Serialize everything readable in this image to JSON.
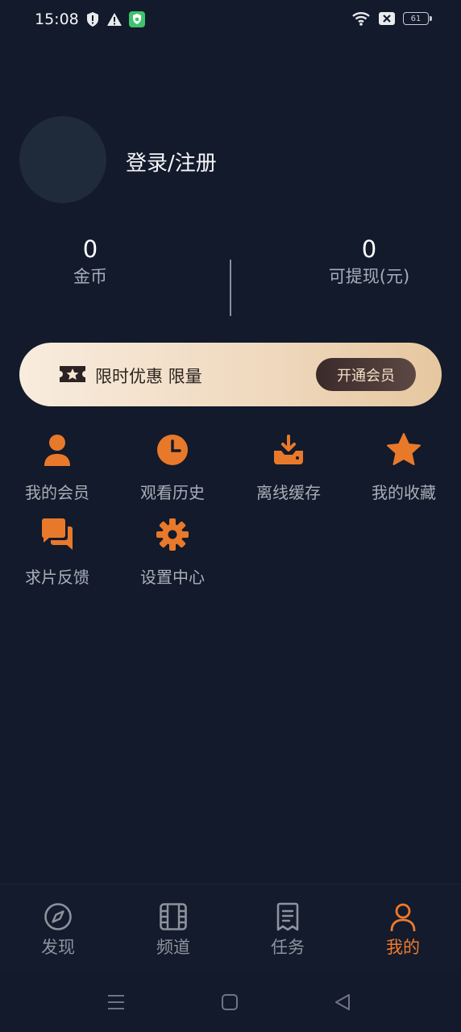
{
  "status_bar": {
    "time": "15:08",
    "battery": "61",
    "icons": [
      "shield-alert-icon",
      "warning-icon",
      "vpn-shield-icon",
      "wifi-icon",
      "no-sim-icon",
      "battery-icon"
    ]
  },
  "profile": {
    "login_label": "登录/注册"
  },
  "stats": {
    "coins_value": "0",
    "coins_label": "金币",
    "withdraw_value": "0",
    "withdraw_label": "可提现(元)"
  },
  "promo": {
    "text": "限时优惠 限量",
    "button": "开通会员"
  },
  "menu": {
    "items": [
      {
        "label": "我的会员",
        "icon": "person-icon"
      },
      {
        "label": "观看历史",
        "icon": "clock-icon"
      },
      {
        "label": "离线缓存",
        "icon": "download-icon"
      },
      {
        "label": "我的收藏",
        "icon": "star-icon"
      },
      {
        "label": "求片反馈",
        "icon": "chat-icon"
      },
      {
        "label": "设置中心",
        "icon": "gear-icon"
      }
    ]
  },
  "tabs": [
    {
      "label": "发现",
      "icon": "compass-icon",
      "active": false
    },
    {
      "label": "频道",
      "icon": "film-icon",
      "active": false
    },
    {
      "label": "任务",
      "icon": "task-icon",
      "active": false
    },
    {
      "label": "我的",
      "icon": "user-icon",
      "active": true
    }
  ],
  "colors": {
    "background": "#121a2b",
    "accent": "#f07a2c",
    "icon_orange": "#e8792b"
  }
}
